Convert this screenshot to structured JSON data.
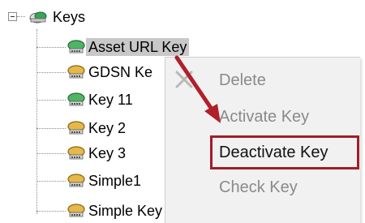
{
  "tree": {
    "root": {
      "label": "Keys",
      "icon": "keys-folder-icon"
    },
    "items": [
      {
        "label": "Asset URL Key",
        "icon": "active-key-icon",
        "selected": true
      },
      {
        "label": "GDSN Ke",
        "icon": "inactive-key-icon"
      },
      {
        "label": "Key 11",
        "icon": "active-key-icon"
      },
      {
        "label": "Key 2",
        "icon": "inactive-key-icon"
      },
      {
        "label": "Key 3",
        "icon": "inactive-key-icon"
      },
      {
        "label": "Simple1",
        "icon": "inactive-key-icon"
      },
      {
        "label": "Simple Key",
        "icon": "inactive-key-icon"
      }
    ]
  },
  "context_menu": {
    "items": [
      {
        "label": "Delete",
        "enabled": false,
        "icon": "delete-x-icon"
      },
      {
        "label": "Activate Key",
        "enabled": false
      },
      {
        "label": "Deactivate Key",
        "enabled": true,
        "highlighted": true
      },
      {
        "label": "Check Key",
        "enabled": false
      }
    ]
  },
  "colors": {
    "selection": "#c8c8c8",
    "highlight_box": "#a01e2a",
    "arrow": "#b0202a",
    "menu_bg": "#f1f1f1",
    "disabled_text": "#8a8a8a",
    "active_key": "#2f9a48",
    "inactive_key": "#d9a52a"
  }
}
